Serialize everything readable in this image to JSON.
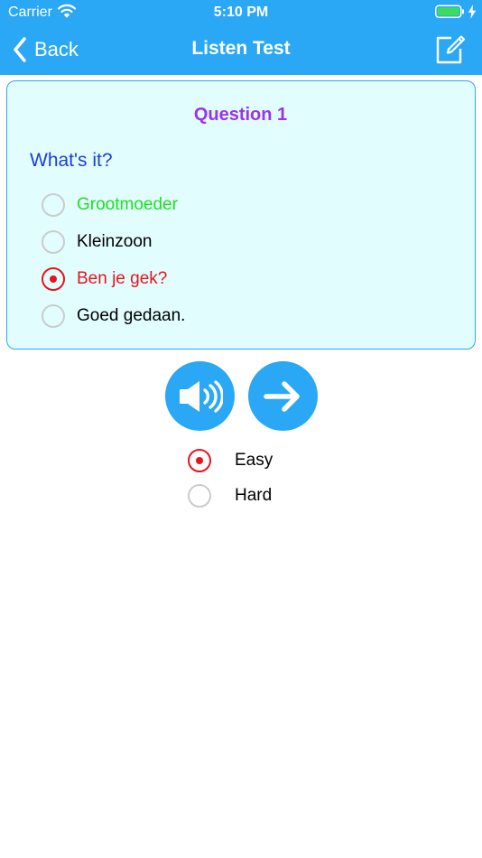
{
  "status_bar": {
    "carrier": "Carrier",
    "time": "5:10 PM",
    "icons": [
      "wifi-icon",
      "battery-icon",
      "charging-bolt-icon"
    ]
  },
  "nav": {
    "back_label": "Back",
    "title": "Listen Test",
    "right_icon": "edit-icon"
  },
  "question": {
    "title": "Question 1",
    "prompt": "What's it?",
    "options": [
      {
        "label": "Grootmoeder",
        "state": "correct"
      },
      {
        "label": "Kleinzoon",
        "state": "unselected"
      },
      {
        "label": "Ben je gek?",
        "state": "selected-wrong"
      },
      {
        "label": "Goed gedaan.",
        "state": "unselected"
      }
    ]
  },
  "controls": {
    "sound_icon": "speaker-icon",
    "next_icon": "arrow-right-icon"
  },
  "difficulty": {
    "options": [
      {
        "label": "Easy",
        "selected": true
      },
      {
        "label": "Hard",
        "selected": false
      }
    ]
  },
  "colors": {
    "accent": "#2AA8F5",
    "card_background": "#E2FDFE",
    "question_title": "#9933EE",
    "prompt": "#1A3FD8",
    "correct": "#1BE01B",
    "wrong": "#E8141B",
    "radio_border": "#CCCCCC"
  }
}
